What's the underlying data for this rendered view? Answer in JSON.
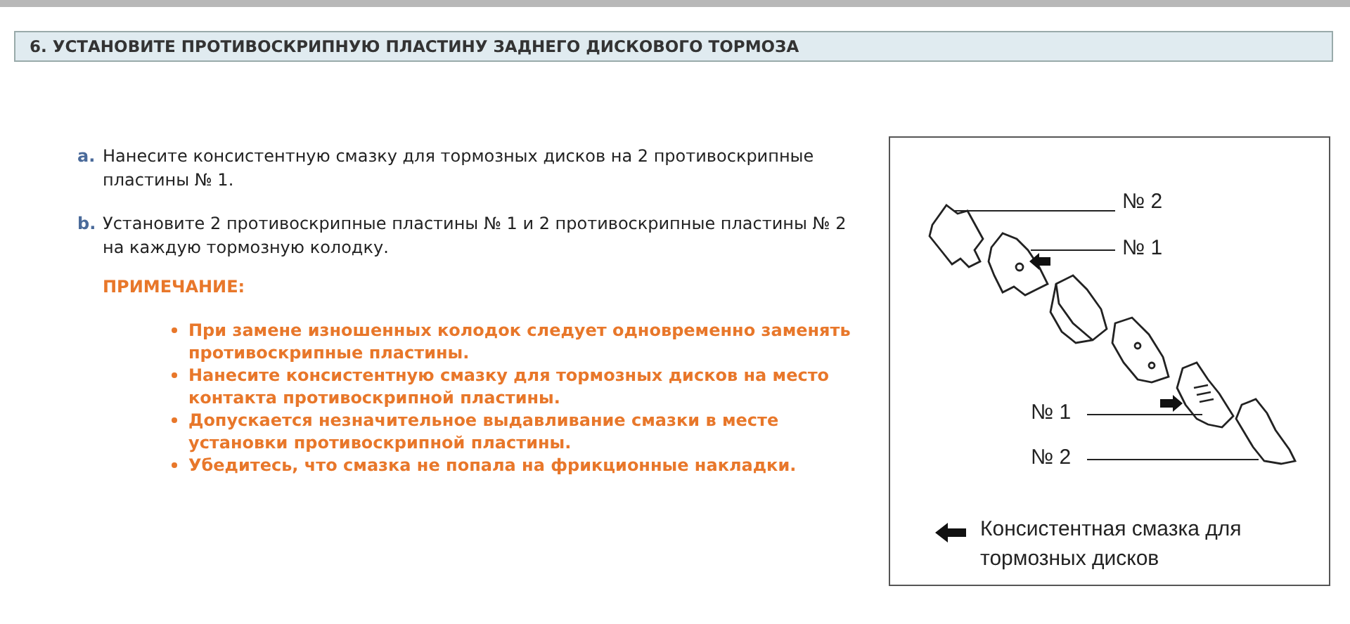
{
  "heading": "6. УСТАНОВИТЕ ПРОТИВОСКРИПНУЮ ПЛАСТИНУ ЗАДНЕГО ДИСКОВОГО ТОРМОЗА",
  "steps": [
    {
      "marker": "a.",
      "text": "Нанесите консистентную смазку для тормозных дисков на 2 противоскрипные пластины № 1."
    },
    {
      "marker": "b.",
      "text": "Установите 2 противоскрипные пластины № 1 и 2 противоскрипные пластины № 2 на каждую тормозную колодку."
    }
  ],
  "note": {
    "title": "ПРИМЕЧАНИЕ:",
    "items": [
      "При замене изношенных колодок следует одновременно заменять противоскрипные пластины.",
      "Нанесите консистентную смазку для тормозных дисков на место контакта противоскрипной пластины.",
      "Допускается незначительное выдавливание смазки в месте установки противоскрипной пластины.",
      "Убедитесь, что смазка не попала на фрикционные накладки."
    ]
  },
  "figure": {
    "labels": [
      "№ 2",
      "№ 1",
      "№ 1",
      "№ 2"
    ],
    "legend": "Консистентная смазка для тормозных дисков"
  }
}
